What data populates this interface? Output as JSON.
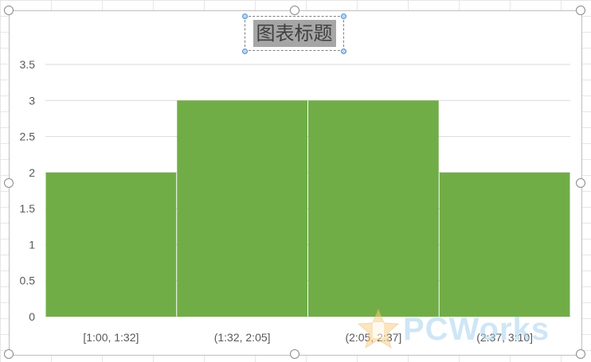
{
  "chart_data": {
    "type": "bar",
    "title": "图表标题",
    "categories": [
      "[1:00, 1:32]",
      "(1:32, 2:05]",
      "(2:05, 2:37]",
      "(2:37, 3:10]"
    ],
    "values": [
      2,
      3,
      3,
      2
    ],
    "ylim": [
      0,
      3.5
    ],
    "yticks": [
      "0",
      "0.5",
      "1",
      "1.5",
      "2",
      "2.5",
      "3",
      "3.5"
    ],
    "xlabel": "",
    "ylabel": "",
    "grid": true,
    "legend": "none",
    "bar_color": "#70ad47",
    "gridline_color": "#d9d9d9"
  },
  "watermark": {
    "text": "PCWorks"
  }
}
